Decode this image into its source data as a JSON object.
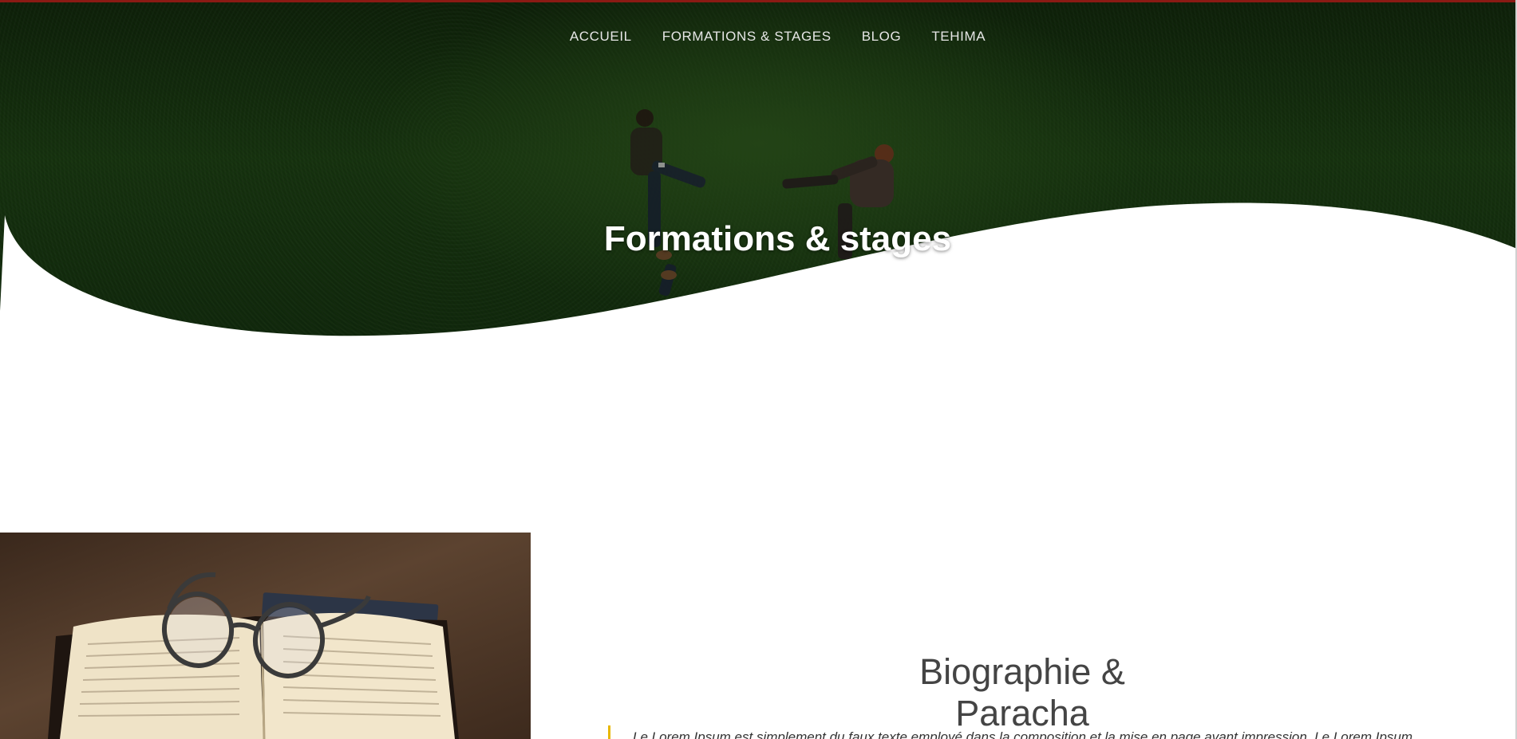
{
  "nav": {
    "items": [
      {
        "label": "ACCUEIL"
      },
      {
        "label": "FORMATIONS & STAGES"
      },
      {
        "label": "BLOG"
      },
      {
        "label": "TEHIMA"
      }
    ]
  },
  "hero": {
    "title": "Formations & stages"
  },
  "biography": {
    "title": "Biographie & Paracha",
    "quote_text": "Le Lorem Ipsum est simplement du faux texte employé dans la composition et la mise en page avant impression. Le Lorem Ipsum"
  },
  "colors": {
    "accent_top_line": "#8b1a14",
    "quote_border": "#e8b700",
    "title_text": "#444444"
  }
}
